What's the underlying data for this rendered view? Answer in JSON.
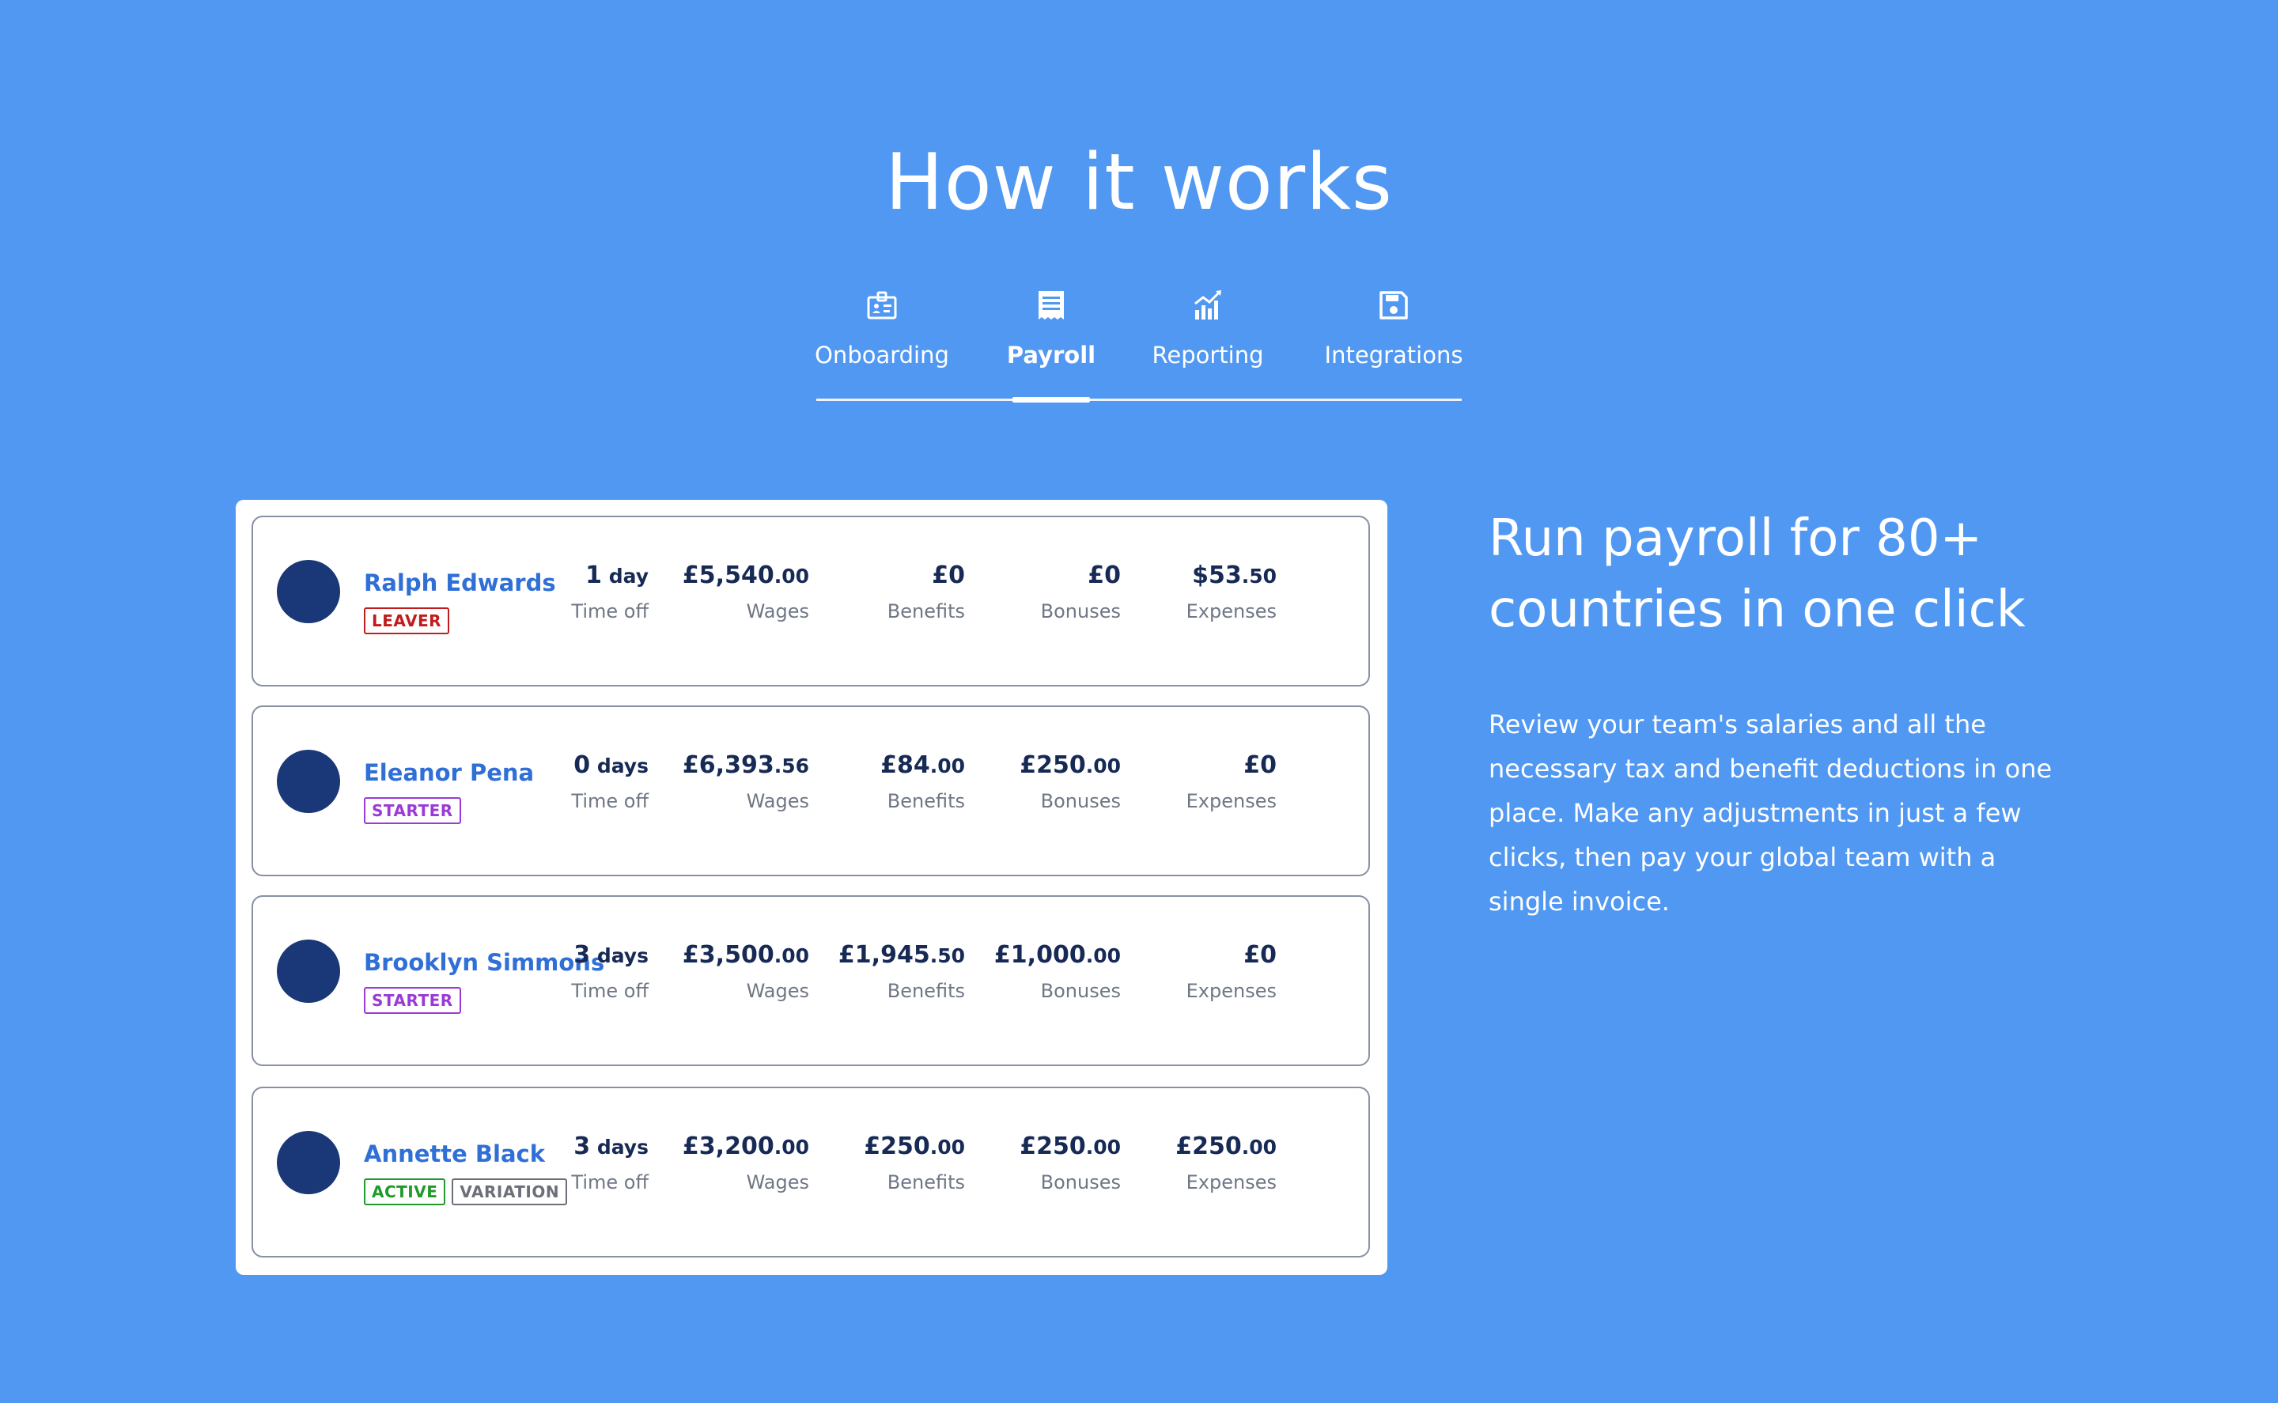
{
  "section_title": "How it works",
  "tabs": [
    {
      "label": "Onboarding",
      "icon": "id-badge-icon",
      "active": false
    },
    {
      "label": "Payroll",
      "icon": "document-list-icon",
      "active": true
    },
    {
      "label": "Reporting",
      "icon": "bar-chart-icon",
      "active": false
    },
    {
      "label": "Integrations",
      "icon": "save-disk-icon",
      "active": false
    }
  ],
  "payroll": {
    "metric_labels": {
      "time_off": "Time off",
      "wages": "Wages",
      "benefits": "Benefits",
      "bonuses": "Bonuses",
      "expenses": "Expenses"
    },
    "rows": [
      {
        "name": "Ralph Edwards",
        "badges": [
          {
            "text": "LEAVER",
            "type": "leaver"
          }
        ],
        "time_off": {
          "main": "1",
          "minor": " day"
        },
        "wages": {
          "main": "£5,540",
          "minor": ".00"
        },
        "benefits": {
          "main": "£0",
          "minor": ""
        },
        "bonuses": {
          "main": "£0",
          "minor": ""
        },
        "expenses": {
          "main": "$53",
          "minor": ".50"
        }
      },
      {
        "name": "Eleanor Pena",
        "badges": [
          {
            "text": "STARTER",
            "type": "starter"
          }
        ],
        "time_off": {
          "main": "0",
          "minor": " days"
        },
        "wages": {
          "main": "£6,393",
          "minor": ".56"
        },
        "benefits": {
          "main": "£84",
          "minor": ".00"
        },
        "bonuses": {
          "main": "£250",
          "minor": ".00"
        },
        "expenses": {
          "main": "£0",
          "minor": ""
        }
      },
      {
        "name": "Brooklyn Simmons",
        "badges": [
          {
            "text": "STARTER",
            "type": "starter"
          }
        ],
        "time_off": {
          "main": "3",
          "minor": " days"
        },
        "wages": {
          "main": "£3,500",
          "minor": ".00"
        },
        "benefits": {
          "main": "£1,945",
          "minor": ".50"
        },
        "bonuses": {
          "main": "£1,000",
          "minor": ".00"
        },
        "expenses": {
          "main": "£0",
          "minor": ""
        }
      },
      {
        "name": "Annette Black",
        "badges": [
          {
            "text": "ACTIVE",
            "type": "active"
          },
          {
            "text": "VARIATION",
            "type": "variation"
          }
        ],
        "time_off": {
          "main": "3",
          "minor": " days"
        },
        "wages": {
          "main": "£3,200",
          "minor": ".00"
        },
        "benefits": {
          "main": "£250",
          "minor": ".00"
        },
        "bonuses": {
          "main": "£250",
          "minor": ".00"
        },
        "expenses": {
          "main": "£250",
          "minor": ".00"
        }
      }
    ]
  },
  "feature": {
    "heading": "Run payroll for 80+ countries in one click",
    "body": "Review your team's salaries and all the necessary tax and benefit deductions in one place. Make any adjustments in just a few clicks, then pay your global team with a single invoice."
  },
  "colors": {
    "background": "#5198f2",
    "name_link": "#2f6fd6",
    "avatar": "#1a3777",
    "leaver": "#c21b1b",
    "starter": "#9b3ad6",
    "active": "#1f9a2b",
    "variation": "#6b6f78"
  }
}
